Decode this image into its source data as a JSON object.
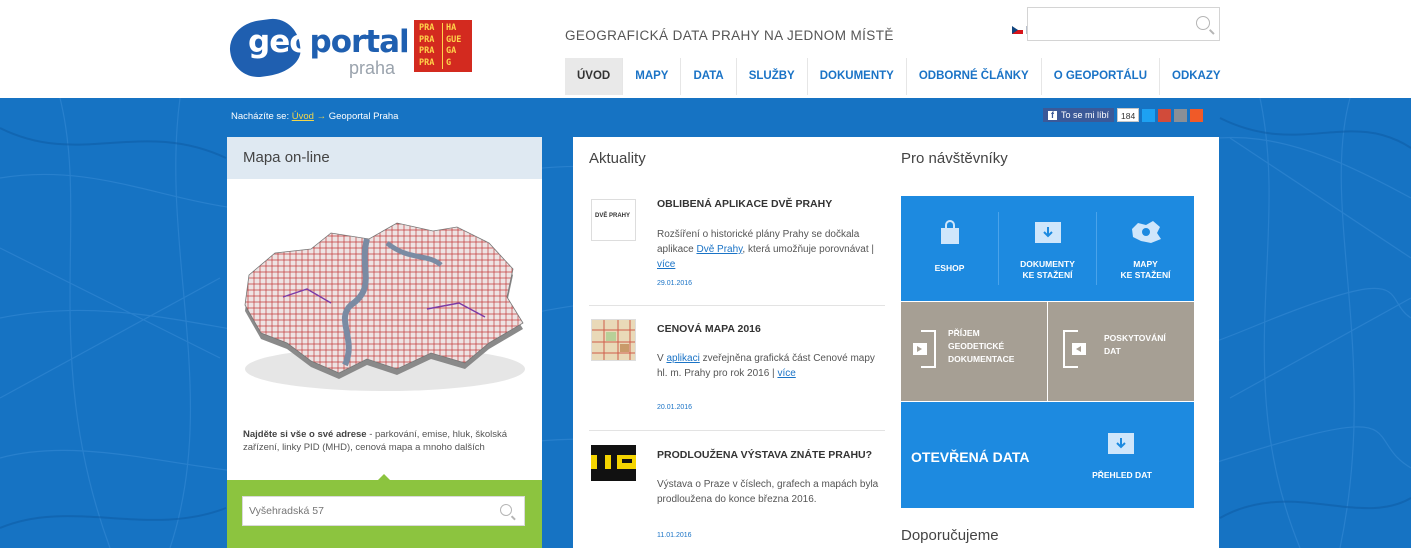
{
  "header": {
    "logo_main": "geo",
    "logo_rest": "portal",
    "logo_sub": "praha",
    "prague_badge": [
      "PRA",
      "HA",
      "PRA",
      "GUE",
      "PRA",
      "GA",
      "PRA",
      "G"
    ],
    "tagline": "GEOGRAFICKÁ DATA PRAHY NA JEDNOM MÍSTĚ",
    "search_value": ""
  },
  "nav": {
    "items": [
      {
        "label": "ÚVOD",
        "active": true
      },
      {
        "label": "MAPY"
      },
      {
        "label": "DATA"
      },
      {
        "label": "SLUŽBY"
      },
      {
        "label": "DOKUMENTY"
      },
      {
        "label": "ODBORNÉ ČLÁNKY"
      },
      {
        "label": "O GEOPORTÁLU"
      },
      {
        "label": "ODKAZY"
      }
    ]
  },
  "breadcrumb": {
    "prefix": "Nacházíte se:",
    "home": "Úvod",
    "arrow": "→",
    "current": "Geoportal Praha"
  },
  "social": {
    "fb_label": "To se mi líbí",
    "fb_count": "184"
  },
  "map_online": {
    "title": "Mapa on-line",
    "note_bold": "Najděte si vše o své adrese",
    "note_rest": " - parkování, emise, hluk, školská zařízení, linky PID (MHD), cenová mapa a mnoho dalších",
    "address_placeholder": "Vyšehradská 57"
  },
  "news": {
    "title": "Aktuality",
    "items": [
      {
        "thumb_text": "DVĚ PRAHY",
        "title": "OBLIBENÁ APLIKACE DVĚ PRAHY",
        "body_1": "Rozšíření o historické plány Prahy se dočkala aplikace ",
        "body_link": "Dvě Prahy",
        "body_2": ", která umožňuje porovnávat | ",
        "more": "více",
        "date": "29.01.2016"
      },
      {
        "title": "CENOVÁ MAPA 2016",
        "body_1": "V ",
        "body_link": "aplikaci",
        "body_2": " zveřejněna grafická část Cenové mapy hl. m. Prahy pro rok 2016 | ",
        "more": "více",
        "date": "20.01.2016"
      },
      {
        "title": "PRODLOUŽENA VÝSTAVA ZNÁTE PRAHU?",
        "body_1": "Výstava o Praze v číslech, grafech a mapách byla prodloužena do konce března 2016.",
        "date": "11.01.2016"
      }
    ]
  },
  "visitors": {
    "title": "Pro návštěvníky",
    "tiles": {
      "eshop": "ESHOP",
      "docs_1": "DOKUMENTY",
      "docs_2": "KE STAŽENÍ",
      "maps_1": "MAPY",
      "maps_2": "KE STAŽENÍ",
      "geo_1": "PŘÍJEM",
      "geo_2": "GEODETICKÉ",
      "geo_3": "DOKUMENTACE",
      "data_1": "POSKYTOVÁNÍ",
      "data_2": "DAT",
      "open_data": "OTEVŘENÁ DATA",
      "overview": "PŘEHLED DAT"
    },
    "recommend": "Doporučujeme"
  },
  "colors": {
    "brand_blue": "#1673c3",
    "tile_blue": "#1d8ae0",
    "tile_grey": "#a69f94",
    "green": "#8cc43f",
    "badge_red": "#d32a1f"
  }
}
